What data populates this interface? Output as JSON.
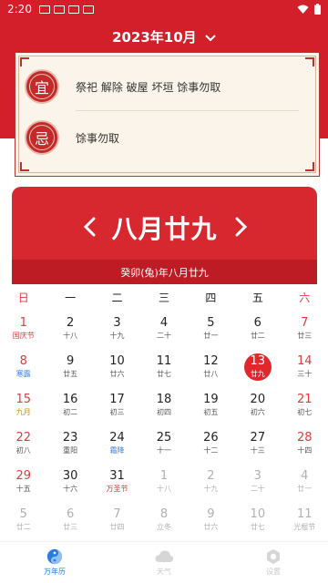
{
  "status_bar": {
    "time": "2:20"
  },
  "header": {
    "month_title": "2023年10月"
  },
  "yiji": {
    "yi_badge": "宜",
    "yi_text": "祭祀 解除 破屋 坏垣 馀事勿取",
    "ji_badge": "忌",
    "ji_text": "馀事勿取"
  },
  "date_panel": {
    "lunar_date": "八月廿九",
    "ganzhi": "癸卯(兔)年八月廿九"
  },
  "calendar": {
    "weekdays": [
      "日",
      "一",
      "二",
      "三",
      "四",
      "五",
      "六"
    ],
    "weeks": [
      [
        {
          "num": "1",
          "sub": "国庆节",
          "w": true,
          "subtype": "festival"
        },
        {
          "num": "2",
          "sub": "十八"
        },
        {
          "num": "3",
          "sub": "十九"
        },
        {
          "num": "4",
          "sub": "二十"
        },
        {
          "num": "5",
          "sub": "廿一"
        },
        {
          "num": "6",
          "sub": "廿二"
        },
        {
          "num": "7",
          "sub": "廿三",
          "w": true
        }
      ],
      [
        {
          "num": "8",
          "sub": "寒露",
          "w": true,
          "subtype": "solar"
        },
        {
          "num": "9",
          "sub": "廿五"
        },
        {
          "num": "10",
          "sub": "廿六"
        },
        {
          "num": "11",
          "sub": "廿七"
        },
        {
          "num": "12",
          "sub": "廿八"
        },
        {
          "num": "13",
          "sub": "廿九",
          "selected": true
        },
        {
          "num": "14",
          "sub": "三十",
          "w": true
        }
      ],
      [
        {
          "num": "15",
          "sub": "九月",
          "w": true,
          "subtype": "gold"
        },
        {
          "num": "16",
          "sub": "初二"
        },
        {
          "num": "17",
          "sub": "初三"
        },
        {
          "num": "18",
          "sub": "初四"
        },
        {
          "num": "19",
          "sub": "初五"
        },
        {
          "num": "20",
          "sub": "初六"
        },
        {
          "num": "21",
          "sub": "初七",
          "w": true
        }
      ],
      [
        {
          "num": "22",
          "sub": "初八",
          "w": true
        },
        {
          "num": "23",
          "sub": "重阳"
        },
        {
          "num": "24",
          "sub": "霜降",
          "subtype": "solar"
        },
        {
          "num": "25",
          "sub": "十一"
        },
        {
          "num": "26",
          "sub": "十二"
        },
        {
          "num": "27",
          "sub": "十三"
        },
        {
          "num": "28",
          "sub": "十四",
          "w": true
        }
      ],
      [
        {
          "num": "29",
          "sub": "十五",
          "w": true
        },
        {
          "num": "30",
          "sub": "十六"
        },
        {
          "num": "31",
          "sub": "万圣节",
          "subtype": "festival"
        },
        {
          "num": "1",
          "sub": "十八",
          "muted": true
        },
        {
          "num": "2",
          "sub": "十九",
          "muted": true
        },
        {
          "num": "3",
          "sub": "二十",
          "muted": true
        },
        {
          "num": "4",
          "sub": "廿一",
          "muted": true
        }
      ],
      [
        {
          "num": "5",
          "sub": "廿二",
          "muted": true
        },
        {
          "num": "6",
          "sub": "廿三",
          "muted": true
        },
        {
          "num": "7",
          "sub": "廿四",
          "muted": true
        },
        {
          "num": "8",
          "sub": "立冬",
          "muted": true
        },
        {
          "num": "9",
          "sub": "廿六",
          "muted": true
        },
        {
          "num": "10",
          "sub": "廿七",
          "muted": true
        },
        {
          "num": "11",
          "sub": "光棍节",
          "muted": true
        }
      ]
    ]
  },
  "bottom_nav": {
    "items": [
      {
        "label": "万年历",
        "icon": "yin-yang-icon",
        "active": true
      },
      {
        "label": "天气",
        "icon": "cloud-icon"
      },
      {
        "label": "设置",
        "icon": "settings-icon"
      }
    ]
  },
  "colors": {
    "accent_red": "#d21f2a",
    "selected_red": "#e2262e",
    "solar_blue": "#3a7ce0",
    "nav_active": "#2a7ddc"
  }
}
